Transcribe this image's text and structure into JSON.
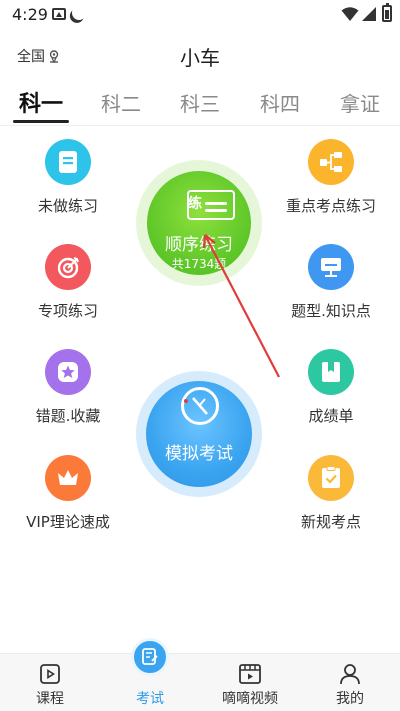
{
  "status_bar": {
    "time": "4:29"
  },
  "header": {
    "region": "全国",
    "title": "小车"
  },
  "tabs": [
    {
      "label": "科一",
      "active": true
    },
    {
      "label": "科二",
      "active": false
    },
    {
      "label": "科三",
      "active": false
    },
    {
      "label": "科四",
      "active": false
    },
    {
      "label": "拿证",
      "active": false
    }
  ],
  "features": {
    "left": [
      {
        "label": "未做练习",
        "icon": "notebook-icon",
        "color": "#2ec4ea"
      },
      {
        "label": "专项练习",
        "icon": "target-icon",
        "color": "#f2585d"
      },
      {
        "label": "错题.收藏",
        "icon": "star-icon",
        "color": "#a472ea"
      },
      {
        "label": "VIP理论速成",
        "icon": "crown-icon",
        "color": "#fb7a3a"
      }
    ],
    "right": [
      {
        "label": "重点考点练习",
        "icon": "flowchart-icon",
        "color": "#fbb52c"
      },
      {
        "label": "题型.知识点",
        "icon": "monitor-icon",
        "color": "#3f97f2"
      },
      {
        "label": "成绩单",
        "icon": "book-icon",
        "color": "#2dc7a1"
      },
      {
        "label": "新规考点",
        "icon": "checklist-icon",
        "color": "#fbb93a"
      }
    ]
  },
  "order_practice": {
    "badge": "练",
    "title": "顺序练习",
    "count": "共1734题",
    "color": "#62c92a"
  },
  "mock_exam": {
    "title": "模拟考试",
    "color": "#3aa4f0"
  },
  "bottom_nav": [
    {
      "label": "课程",
      "icon": "video-course-icon",
      "active": false
    },
    {
      "label": "考试",
      "icon": "exam-icon",
      "active": true
    },
    {
      "label": "嘀嘀视频",
      "icon": "film-icon",
      "active": false
    },
    {
      "label": "我的",
      "icon": "person-icon",
      "active": false
    }
  ]
}
